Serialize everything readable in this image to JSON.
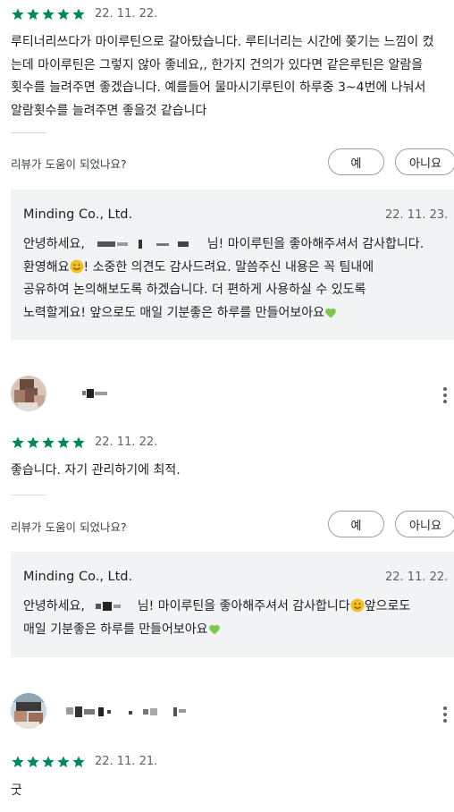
{
  "review1": {
    "date": "22. 11. 22.",
    "text": "루티너리쓰다가 마이루틴으로 갈아탔습니다. 루티너리는 시간에 쫒기는 느낌이 컸는데 마이루틴은 그렇지 않아 좋네요,, 한가지 건의가 있다면 같은루틴은 알람을 횟수를 늘려주면 좋겠습니다. 예를들어 물마시기루틴이 하루중 3~4번에 나눠서 알람횟수를 늘려주면 좋을것 같습니다",
    "helpful_question": "리뷰가 도움이 되었나요?",
    "yes_label": "예",
    "no_label": "아니요",
    "reply": {
      "developer": "Minding Co., Ltd.",
      "date": "22. 11. 23.",
      "greeting": "안녕하세요,",
      "after_name": "님! 마이루틴을 좋아해주셔서 감사합니다.",
      "line2a": "환영해요",
      "line2b": "! 소중한 의견도 감사드려요. 말씀주신 내용은 꼭 팀내에",
      "line3": "공유하여 논의해보도록 하겠습니다. 더 편하게 사용하실 수 있도록",
      "line4": "노력할게요! 앞으로도 매일 기분좋은 하루를 만들어보아요"
    }
  },
  "review2": {
    "date": "22. 11. 22.",
    "text": "좋습니다. 자기 관리하기에 최적.",
    "helpful_question": "리뷰가 도움이 되었나요?",
    "yes_label": "예",
    "no_label": "아니요",
    "reply": {
      "developer": "Minding Co., Ltd.",
      "date": "22. 11. 22.",
      "greeting": "안녕하세요,",
      "after_name": "님! 마이루틴을 좋아해주셔서 감사합니다",
      "line1b": "앞으로도",
      "line2": "매일 기분좋은 하루를 만들어보아요"
    }
  },
  "review3": {
    "date": "22. 11. 21.",
    "text": "굿"
  },
  "colors": {
    "star": "#01875f",
    "reply_bg": "#f1f3f4",
    "heart": "#7cc94a",
    "smile": "#f6c021"
  }
}
